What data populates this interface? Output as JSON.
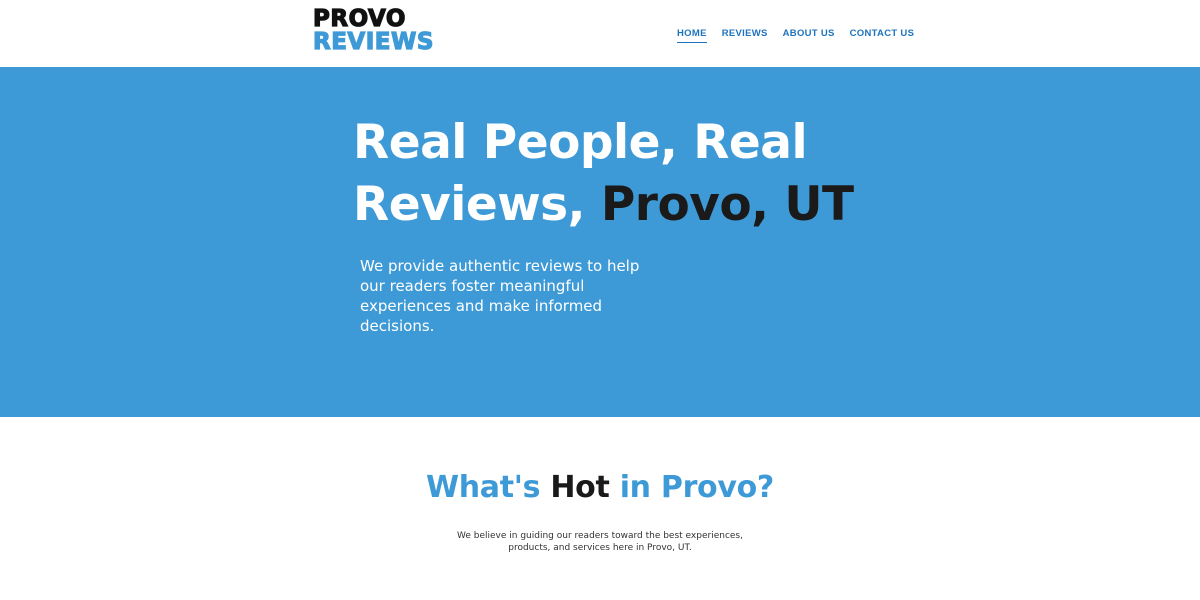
{
  "logo": {
    "line1": "PROVO",
    "line2": "REVIEWS"
  },
  "nav": {
    "items": [
      {
        "label": "HOME",
        "active": true
      },
      {
        "label": "REVIEWS"
      },
      {
        "label": "ABOUT US"
      },
      {
        "label": "CONTACT US"
      }
    ]
  },
  "hero": {
    "title_line1": "Real People, Real",
    "title_line2_white": "Reviews, ",
    "title_line2_dark": "Provo, UT",
    "description": "We provide authentic reviews to help our readers foster meaningful experiences and make informed decisions."
  },
  "hot": {
    "title_part1": "What's ",
    "title_part2": "Hot",
    "title_part3": " in Provo?",
    "description": "We believe in guiding our readers toward the best experiences, products, and services here in Provo, UT."
  },
  "colors": {
    "brand_blue": "#3e9ad6",
    "nav_blue": "#1e73be",
    "dark": "#1a1a1a"
  }
}
